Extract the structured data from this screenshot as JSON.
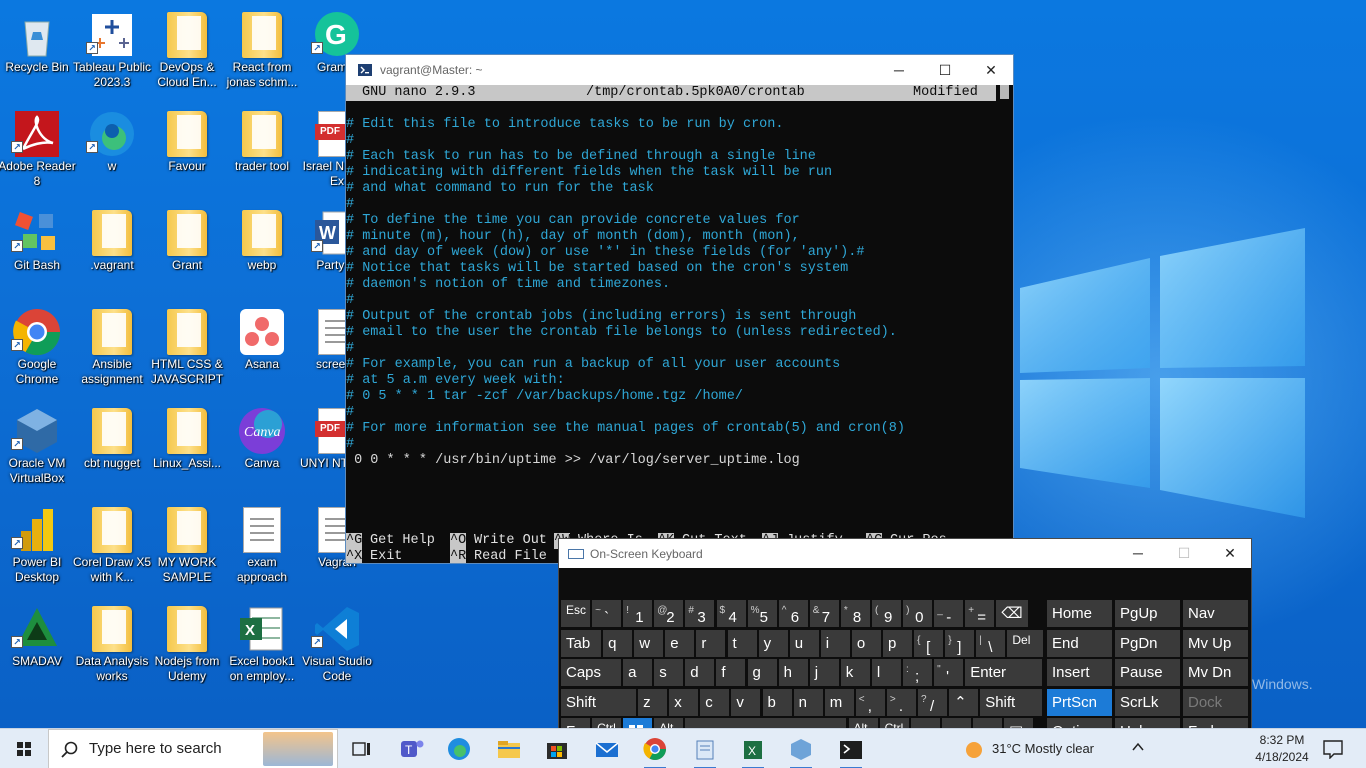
{
  "desktop": {
    "icons": [
      {
        "label": "Recycle Bin",
        "icon": "recycle-bin-icon"
      },
      {
        "label": "Tableau Public 2023.3",
        "icon": "tableau-icon"
      },
      {
        "label": "DevOps & Cloud En...",
        "icon": "folder-icon"
      },
      {
        "label": "React from jonas schm...",
        "icon": "folder-icon"
      },
      {
        "label": "Gramm",
        "icon": "grammarly-icon"
      },
      {
        "label": "Adobe Reader 8",
        "icon": "adobe-reader-icon"
      },
      {
        "label": "w",
        "icon": "edge-icon"
      },
      {
        "label": "Favour",
        "icon": "folder-icon"
      },
      {
        "label": "trader tool",
        "icon": "folder-icon"
      },
      {
        "label": "Israel N CV - Ex",
        "icon": "pdf-icon"
      },
      {
        "label": "Git Bash",
        "icon": "git-bash-icon"
      },
      {
        "label": ".vagrant",
        "icon": "folder-icon"
      },
      {
        "label": "Grant",
        "icon": "folder-icon"
      },
      {
        "label": "webp",
        "icon": "folder-icon"
      },
      {
        "label": "Party M",
        "icon": "word-icon"
      },
      {
        "label": "Google Chrome",
        "icon": "chrome-icon"
      },
      {
        "label": "Ansible assignment",
        "icon": "folder-icon"
      },
      {
        "label": "HTML CSS & JAVASCRIPT",
        "icon": "folder-icon"
      },
      {
        "label": "Asana",
        "icon": "asana-icon"
      },
      {
        "label": "screens",
        "icon": "document-icon"
      },
      {
        "label": "Oracle VM VirtualBox",
        "icon": "virtualbox-icon"
      },
      {
        "label": "cbt nugget",
        "icon": "folder-icon"
      },
      {
        "label": "Linux_Assi...",
        "icon": "folder-icon"
      },
      {
        "label": "Canva",
        "icon": "canva-icon"
      },
      {
        "label": "UNYI NTEILE",
        "icon": "pdf-icon"
      },
      {
        "label": "Power BI Desktop",
        "icon": "power-bi-icon"
      },
      {
        "label": "Corel Draw X5 with K...",
        "icon": "folder-icon"
      },
      {
        "label": "MY WORK SAMPLE",
        "icon": "folder-icon"
      },
      {
        "label": "exam approach",
        "icon": "document-icon"
      },
      {
        "label": "Vagran",
        "icon": "document-icon"
      },
      {
        "label": "SMADAV",
        "icon": "smadav-icon"
      },
      {
        "label": "Data Analysis works",
        "icon": "folder-icon"
      },
      {
        "label": "Nodejs from Udemy",
        "icon": "folder-icon"
      },
      {
        "label": "Excel book1 on employ...",
        "icon": "excel-icon"
      },
      {
        "label": "Visual Studio Code",
        "icon": "vscode-icon"
      }
    ],
    "watermark": "Windows."
  },
  "terminal": {
    "title": "vagrant@Master: ~",
    "nano_header": {
      "version": "GNU nano 2.9.3",
      "file": "/tmp/crontab.5pk0A0/crontab",
      "status": "Modified"
    },
    "lines": [
      "# Edit this file to introduce tasks to be run by cron.",
      "#",
      "# Each task to run has to be defined through a single line",
      "# indicating with different fields when the task will be run",
      "# and what command to run for the task",
      "#",
      "# To define the time you can provide concrete values for",
      "# minute (m), hour (h), day of month (dom), month (mon),",
      "# and day of week (dow) or use '*' in these fields (for 'any').#",
      "# Notice that tasks will be started based on the cron's system",
      "# daemon's notion of time and timezones.",
      "#",
      "# Output of the crontab jobs (including errors) is sent through",
      "# email to the user the crontab file belongs to (unless redirected).",
      "#",
      "# For example, you can run a backup of all your user accounts",
      "# at 5 a.m every week with:",
      "# 0 5 * * 1 tar -zcf /var/backups/home.tgz /home/",
      "#",
      "# For more information see the manual pages of crontab(5) and cron(8)",
      "#"
    ],
    "command_line": " 0 0 * * * /usr/bin/uptime >> /var/log/server_uptime.log",
    "shortcuts_row1": [
      {
        "key": "^G",
        "label": "Get Help"
      },
      {
        "key": "^O",
        "label": "Write Out"
      },
      {
        "key": "^W",
        "label": "Where Is"
      },
      {
        "key": "^K",
        "label": "Cut Text"
      },
      {
        "key": "^J",
        "label": "Justify"
      },
      {
        "key": "^C",
        "label": "Cur Pos"
      }
    ],
    "shortcuts_row2": [
      {
        "key": "^X",
        "label": "Exit"
      },
      {
        "key": "^R",
        "label": "Read File"
      }
    ]
  },
  "osk": {
    "title": "On-Screen Keyboard",
    "row1": [
      {
        "main": "Esc"
      },
      {
        "shift": "~",
        "main": "`"
      },
      {
        "shift": "!",
        "main": "1"
      },
      {
        "shift": "@",
        "main": "2"
      },
      {
        "shift": "#",
        "main": "3"
      },
      {
        "shift": "$",
        "main": "4"
      },
      {
        "shift": "%",
        "main": "5"
      },
      {
        "shift": "^",
        "main": "6"
      },
      {
        "shift": "&",
        "main": "7"
      },
      {
        "shift": "*",
        "main": "8"
      },
      {
        "shift": "(",
        "main": "9"
      },
      {
        "shift": ")",
        "main": "0"
      },
      {
        "shift": "_",
        "main": "-"
      },
      {
        "shift": "+",
        "main": "="
      },
      {
        "main": "⌫"
      }
    ],
    "row2": [
      "Tab",
      "q",
      "w",
      "e",
      "r",
      "t",
      "y",
      "u",
      "i",
      "o",
      "p",
      "[",
      "]",
      "\\",
      "Del"
    ],
    "row2_shift": {
      "[": "{",
      "]": "}",
      "\\": "|"
    },
    "row3": [
      "Caps",
      "a",
      "s",
      "d",
      "f",
      "g",
      "h",
      "j",
      "k",
      "l",
      ";",
      "'",
      "Enter"
    ],
    "row3_shift": {
      ";": ":",
      "'": "\""
    },
    "row4": [
      "Shift",
      "z",
      "x",
      "c",
      "v",
      "b",
      "n",
      "m",
      ",",
      ".",
      "/",
      "^",
      "Shift"
    ],
    "row4_shift": {
      ",": "<",
      ".": ">",
      "/": "?"
    },
    "row5": [
      "Fn",
      "Ctrl",
      "Win",
      "Alt",
      "",
      "Alt",
      "Ctrl",
      "<",
      "v",
      ">",
      "Menu"
    ],
    "nav": [
      [
        "Home",
        "PgUp",
        "Nav"
      ],
      [
        "End",
        "PgDn",
        "Mv Up"
      ],
      [
        "Insert",
        "Pause",
        "Mv Dn"
      ],
      [
        "PrtScn",
        "ScrLk",
        "Dock"
      ],
      [
        "Options",
        "Help",
        "Fade"
      ]
    ]
  },
  "taskbar": {
    "search_placeholder": "Type here to search",
    "weather": "31°C  Mostly clear",
    "time": "8:32 PM",
    "date": "4/18/2024"
  }
}
